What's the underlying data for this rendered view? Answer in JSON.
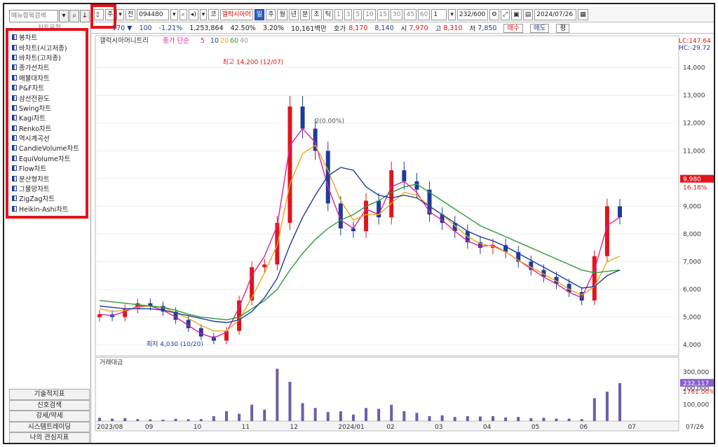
{
  "left_panel": {
    "search_placeholder": "메뉴항목검색",
    "header": "차트유형",
    "chart_types": [
      "봉차트",
      "바차트(시고저종)",
      "바차트(고저종)",
      "종가선차트",
      "매물대차트",
      "P&F차트",
      "삼선전환도",
      "Swing차트",
      "Kagi차트",
      "Renko차트",
      "역시계곡선",
      "CandleVolume차트",
      "EquiVolume차트",
      "Flow차트",
      "분산형차트",
      "그물망차트",
      "ZigZag차트",
      "Heikin-Ashi차트"
    ],
    "bottom_buttons": [
      "기술적지표",
      "신호검색",
      "강세/약세",
      "시스템트레이딩",
      "나의 관심지표"
    ]
  },
  "toolbar": {
    "period_label": "주",
    "prev_label": "전",
    "code": "094480",
    "stock_name": "갤럭시아머",
    "tf_labels": [
      "일",
      "주",
      "월",
      "년",
      "분",
      "초",
      "틱"
    ],
    "minute_options": [
      "1",
      "3",
      "5",
      "10",
      "15",
      "30",
      "45",
      "60"
    ],
    "interval_value": "1",
    "count": "232/600",
    "date": "2024/07/26"
  },
  "quote": {
    "change": "170 ▼",
    "amount": "100",
    "change_pct": "-1.21%",
    "volume": "1,253,864",
    "rate": "42.50%",
    "rate2": "3.20%",
    "value": "10,161백만",
    "hoga_label": "호가",
    "hoga_ask": "8,170",
    "hoga_bid": "8,140",
    "open_label": "시",
    "open": "7,970",
    "high_label": "고",
    "high": "8,310",
    "low_label": "저",
    "low": "7,850",
    "buy_label": "매수",
    "sell_label": "매도",
    "flat_label": "평"
  },
  "chart": {
    "legend_name": "갤럭시아머니트리",
    "legend_ma_label": "종가 단순",
    "ma_periods": [
      "5",
      "10",
      "20",
      "60",
      "40"
    ],
    "ma_colors": [
      "#e0209a",
      "#1f3c9a",
      "#e8a81c",
      "#2e9a3c",
      "#9a9a9a"
    ],
    "lc_label": "LC:147.64",
    "hc_label": "HC:-29.72",
    "high_annot": "최고 14,200 (12/07)",
    "low_annot": "최저 4,030 (10/20)",
    "mid_annot": "2(0.00%)",
    "current_price": "9,980",
    "current_pct": "16.18%",
    "volume_label": "거래대금",
    "volume_current": "232,117",
    "volume_pct": "1761.00%",
    "price_ticks": [
      "14,000",
      "13,000",
      "12,000",
      "11,000",
      "10,000",
      "9,000",
      "8,000",
      "7,000",
      "6,000",
      "5,000",
      "4,000"
    ],
    "volume_ticks": [
      "300,000",
      "200,000",
      "100,000"
    ],
    "x_labels": [
      "2023/08",
      "09",
      "10",
      "11",
      "12",
      "2024/01",
      "02",
      "03",
      "04",
      "05",
      "06",
      "07"
    ],
    "x_end_label": "07/26",
    "colors": {
      "up": "#e0141b",
      "down": "#1f3c9a"
    }
  },
  "chart_data": {
    "type": "candlestick",
    "title": "갤럭시아머니트리",
    "ylim": [
      3700,
      14800
    ],
    "volume_ylim": [
      0,
      330000
    ],
    "x_range": [
      "2023/08",
      "2024/07/26"
    ],
    "legend": "top-left",
    "series": [
      {
        "name": "종가",
        "values": [
          5100,
          5000,
          5300,
          5500,
          5400,
          5200,
          4900,
          4600,
          4300,
          4150,
          4500,
          5600,
          6800,
          6900,
          8400,
          12600,
          11800,
          11000,
          9100,
          8200,
          8100,
          9200,
          8600,
          10300,
          9900,
          9600,
          8700,
          8400,
          8100,
          7700,
          7500,
          7600,
          7350,
          7000,
          6700,
          6450,
          6200,
          5900,
          5600,
          7200,
          9000,
          8600
        ]
      },
      {
        "name": "MA5",
        "values": [
          5100,
          5050,
          5200,
          5400,
          5400,
          5250,
          5000,
          4700,
          4400,
          4250,
          4450,
          5350,
          6500,
          7200,
          8300,
          11200,
          11800,
          11300,
          9700,
          8500,
          8200,
          8900,
          8700,
          9700,
          9900,
          9500,
          8800,
          8500,
          8100,
          7750,
          7550,
          7600,
          7350,
          7050,
          6750,
          6450,
          6200,
          5900,
          5700,
          6700,
          8300,
          8600
        ]
      },
      {
        "name": "MA20",
        "values": [
          5300,
          5200,
          5250,
          5350,
          5400,
          5350,
          5150,
          4950,
          4700,
          4500,
          4500,
          4900,
          5700,
          6600,
          7600,
          9800,
          10900,
          11200,
          10300,
          9200,
          8500,
          8700,
          8700,
          9100,
          9500,
          9400,
          9000,
          8700,
          8300,
          7900,
          7650,
          7550,
          7350,
          7050,
          6800,
          6550,
          6300,
          6000,
          5800,
          6100,
          7000,
          7200
        ]
      },
      {
        "name": "MA60",
        "values": [
          5600,
          5550,
          5500,
          5450,
          5400,
          5350,
          5250,
          5100,
          5000,
          4950,
          4900,
          5000,
          5300,
          5600,
          6000,
          6700,
          7300,
          7800,
          8200,
          8500,
          8700,
          9000,
          9200,
          9500,
          9700,
          9800,
          9500,
          9200,
          8900,
          8600,
          8300,
          8100,
          7900,
          7700,
          7500,
          7300,
          7100,
          6900,
          6700,
          6600,
          6650,
          6700
        ]
      },
      {
        "name": "MA40",
        "values": [
          5400,
          5350,
          5300,
          5300,
          5300,
          5250,
          5150,
          5050,
          4950,
          4850,
          4800,
          4900,
          5200,
          5700,
          6400,
          7600,
          8600,
          9400,
          10100,
          10400,
          10300,
          9700,
          9400,
          9300,
          9400,
          9300,
          9000,
          8700,
          8400,
          8100,
          7900,
          7750,
          7550,
          7300,
          7050,
          6800,
          6550,
          6300,
          6050,
          6100,
          6500,
          6700
        ]
      }
    ],
    "volume": [
      20000,
      15000,
      18000,
      12000,
      10000,
      9000,
      14000,
      11000,
      12000,
      30000,
      60000,
      45000,
      100000,
      70000,
      320000,
      240000,
      110000,
      80000,
      55000,
      60000,
      40000,
      80000,
      75000,
      100000,
      60000,
      50000,
      30000,
      35000,
      25000,
      30000,
      28000,
      30000,
      22000,
      25000,
      18000,
      20000,
      15000,
      15000,
      12000,
      140000,
      180000,
      232117
    ]
  }
}
